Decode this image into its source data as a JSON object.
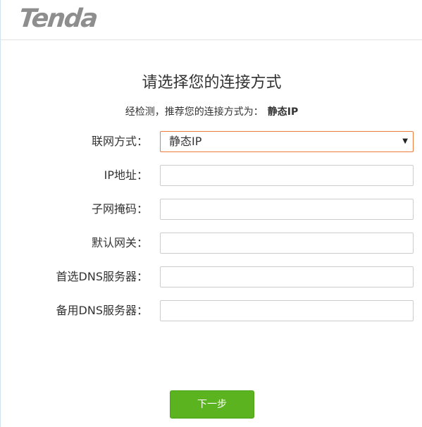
{
  "brand": {
    "logo_text": "Tenda"
  },
  "page": {
    "title": "请选择您的连接方式",
    "detect_prefix": "经检测，推荐您的连接方式为：",
    "detect_value": "静态IP"
  },
  "form": {
    "connection_type": {
      "label": "联网方式：",
      "value": "静态IP"
    },
    "ip_address": {
      "label": "IP地址：",
      "value": ""
    },
    "subnet_mask": {
      "label": "子网掩码：",
      "value": ""
    },
    "gateway": {
      "label": "默认网关：",
      "value": ""
    },
    "primary_dns": {
      "label": "首选DNS服务器：",
      "value": ""
    },
    "secondary_dns": {
      "label": "备用DNS服务器：",
      "value": ""
    }
  },
  "actions": {
    "next_label": "下一步"
  },
  "colors": {
    "accent_orange": "#ee7d3b",
    "button_green": "#5bb41f",
    "logo_gray": "#8e8e8e"
  }
}
